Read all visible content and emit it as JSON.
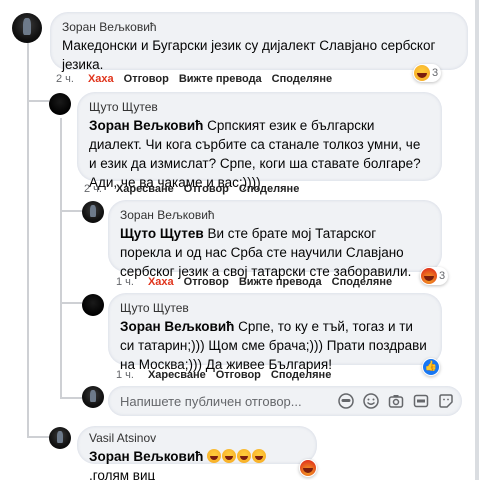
{
  "comments": [
    {
      "author": "Зоран Вељковић",
      "text": "Македонски и Бугарски језик су дијалект Славјано сербског језика.",
      "time": "2 ч.",
      "reaction_label": "Хаха",
      "reply_label": "Отговор",
      "translation_label": "Вижте превода",
      "share_label": "Споделяне",
      "reaction_count": "3"
    },
    {
      "author": "Щуто Щутев",
      "mention": "Зоран Вељковић",
      "text": " Српският език е български диалект. Чи кога сърбите са станале толкоз умни, че и език да измислат? Српе, коги ша ставате болгаре? Ади, че ва чакаме и вас;))))",
      "time": "2 ч.",
      "like_label": "Харесване",
      "reply_label": "Отговор",
      "share_label": "Споделяне"
    },
    {
      "author": "Зоран Вељковић",
      "mention": "Щуто Щутев",
      "text": " Ви сте брате мој Татарског порекла и од нас Срба сте научили Славјано сербског језик а свој татарски сте заборавили.",
      "time": "1 ч.",
      "reaction_label": "Хаха",
      "reply_label": "Отговор",
      "translation_label": "Вижте превода",
      "share_label": "Споделяне",
      "reaction_count": "3"
    },
    {
      "author": "Щуто Щутев",
      "mention": "Зоран Вељковић",
      "text": " Српе, то ку е тъй, тогаз и ти си татарин;))) Щом сме брача;))) Прати поздрави на Москва;))) Да живее България!",
      "time": "1 ч.",
      "like_label": "Харесване",
      "reply_label": "Отговор",
      "share_label": "Споделяне"
    },
    {
      "author": "Vasil Atsinov",
      "mention": "Зоран Вељковић",
      "text": ",голям виц"
    }
  ],
  "reply_box": {
    "placeholder": "Напишете публичен отговор..."
  }
}
